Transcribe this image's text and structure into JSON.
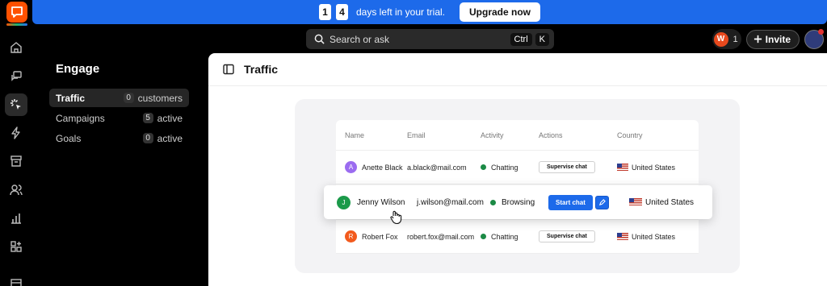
{
  "banner": {
    "digit1": "1",
    "digit2": "4",
    "text": "days left in your trial.",
    "upgrade_label": "Upgrade now",
    "color": "#1d6aea"
  },
  "search": {
    "placeholder": "Search or ask",
    "key1": "Ctrl",
    "key2": "K"
  },
  "topbar": {
    "workspace_initial": "W",
    "workspace_count": "1",
    "invite_label": "Invite"
  },
  "sidebar": {
    "title": "Engage",
    "items": [
      {
        "label": "Traffic",
        "count": "0",
        "suffix": "customers"
      },
      {
        "label": "Campaigns",
        "count": "5",
        "suffix": "active"
      },
      {
        "label": "Goals",
        "count": "0",
        "suffix": "active"
      }
    ]
  },
  "page": {
    "title": "Traffic"
  },
  "table": {
    "headers": {
      "name": "Name",
      "email": "Email",
      "activity": "Activity",
      "actions": "Actions",
      "country": "Country"
    },
    "rows": [
      {
        "initial": "A",
        "name": "Anette Black",
        "email": "a.black@mail.com",
        "activity": "Chatting",
        "action": "Supervise chat",
        "country": "United States",
        "avatar_color": "#9b6cf0"
      },
      {
        "initial": "J",
        "name": "Jenny Wilson",
        "email": "j.wilson@mail.com",
        "activity": "Browsing",
        "action": "Start chat",
        "country": "United States",
        "avatar_color": "#1b9a4a"
      },
      {
        "initial": "R",
        "name": "Robert Fox",
        "email": "robert.fox@mail.com",
        "activity": "Chatting",
        "action": "Supervise chat",
        "country": "United States",
        "avatar_color": "#f25a1d"
      }
    ]
  },
  "icons": {
    "rail": [
      "logo-icon",
      "home-icon",
      "chats-icon",
      "engage-icon",
      "automate-icon",
      "archives-icon",
      "customers-icon",
      "reports-icon",
      "apps-icon"
    ]
  },
  "colors": {
    "accent": "#1d6aea",
    "brand": "#ff5100",
    "status_green": "#1b8a45"
  }
}
